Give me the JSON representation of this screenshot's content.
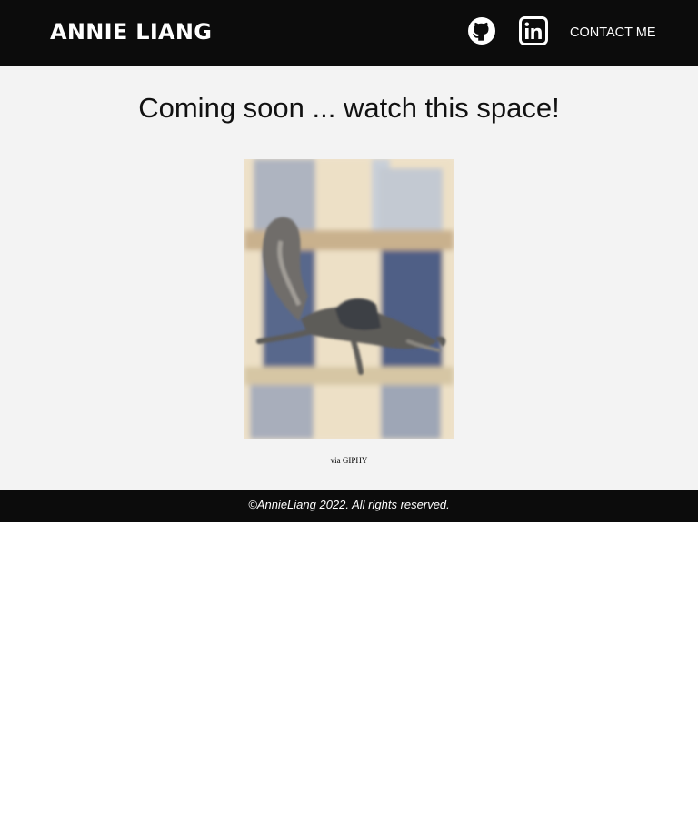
{
  "header": {
    "brand": "ANNIE LIANG",
    "github_icon": "github-icon",
    "linkedin_icon": "linkedin-icon",
    "contact_label": "CONTACT ME"
  },
  "main": {
    "headline": "Coming soon ... watch this space!",
    "gif_subject": "flying-squirrel-gif",
    "caption_prefix": "via",
    "caption_link": "GIPHY"
  },
  "footer": {
    "copyright": "©AnnieLiang 2022. All rights reserved."
  },
  "colors": {
    "bar_background": "#0c0c0c",
    "page_background": "#f3f3f3",
    "text_light": "#ffffff",
    "text_dark": "#111111"
  }
}
